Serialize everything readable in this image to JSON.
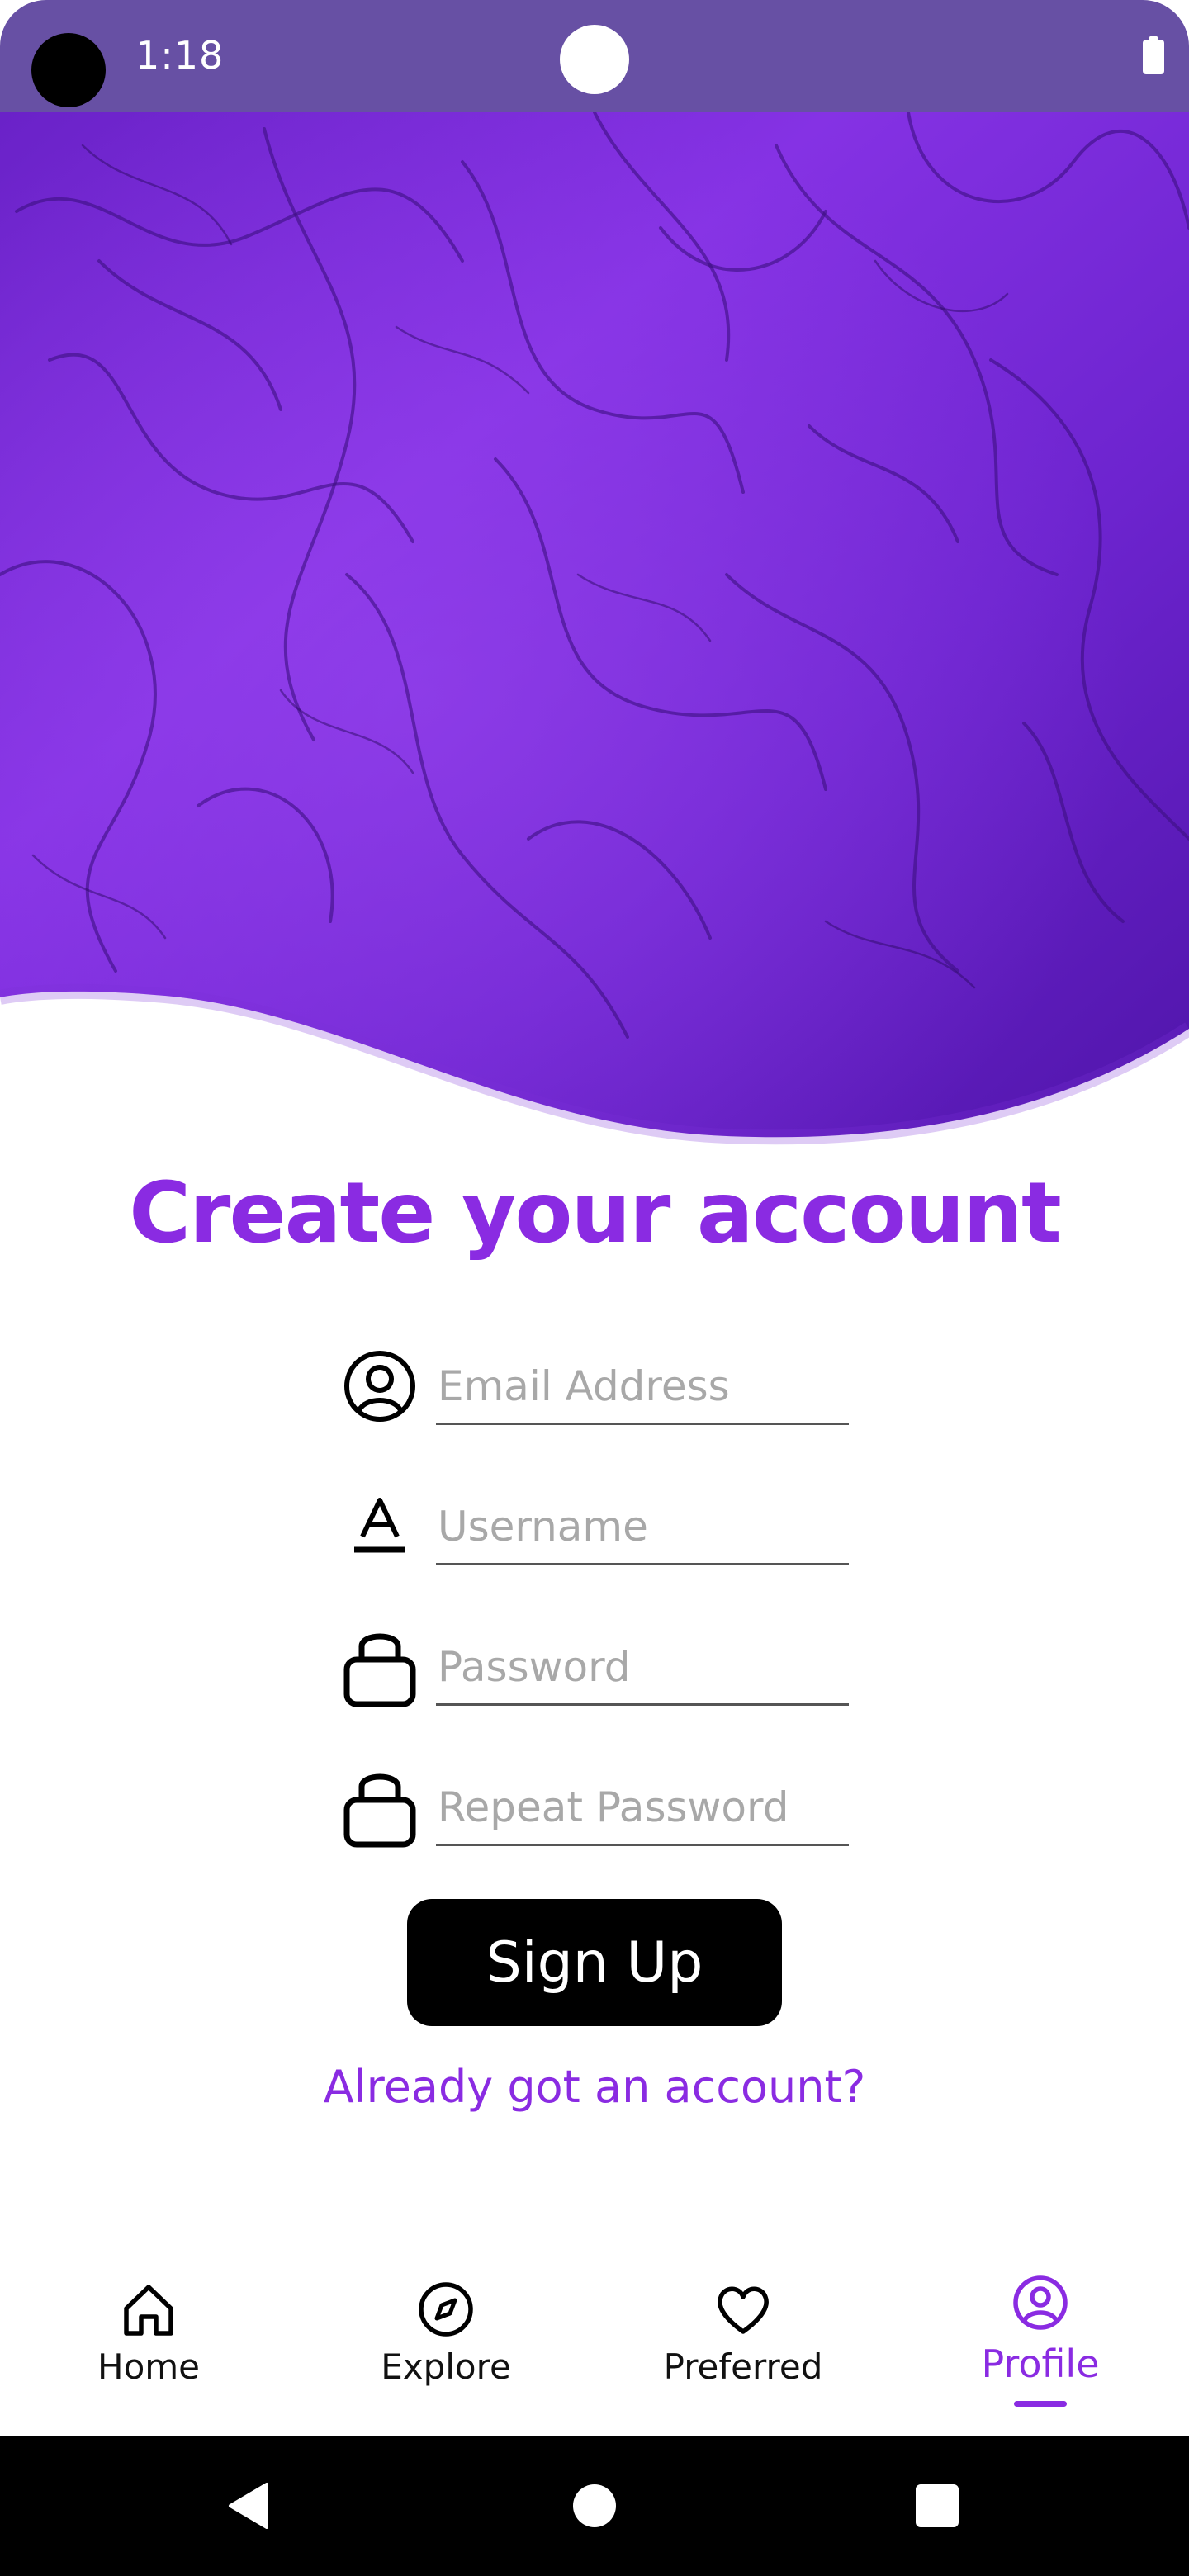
{
  "status_bar": {
    "time": "1:18"
  },
  "colors": {
    "status_bar": "#6750a4",
    "accent": "#8a2be2",
    "hero_purple": "#7a2fd9",
    "button": "#000000"
  },
  "header": {
    "title": "Create your account"
  },
  "form": {
    "email": {
      "placeholder": "Email Address",
      "value": "",
      "icon": "user-circle-icon"
    },
    "username": {
      "placeholder": "Username",
      "value": "",
      "icon": "text-format-icon"
    },
    "password": {
      "placeholder": "Password",
      "value": "",
      "icon": "lock-icon"
    },
    "repeat_password": {
      "placeholder": "Repeat Password",
      "value": "",
      "icon": "lock-icon"
    }
  },
  "actions": {
    "signup_label": "Sign Up",
    "login_link": "Already got an account?"
  },
  "bottom_nav": {
    "items": [
      {
        "label": "Home",
        "icon": "home-icon",
        "active": false
      },
      {
        "label": "Explore",
        "icon": "compass-icon",
        "active": false
      },
      {
        "label": "Preferred",
        "icon": "heart-icon",
        "active": false
      },
      {
        "label": "Profile",
        "icon": "user-circle-icon",
        "active": true
      }
    ]
  },
  "system_nav": {
    "buttons": [
      "back-icon",
      "home-circle-icon",
      "recents-icon"
    ]
  }
}
